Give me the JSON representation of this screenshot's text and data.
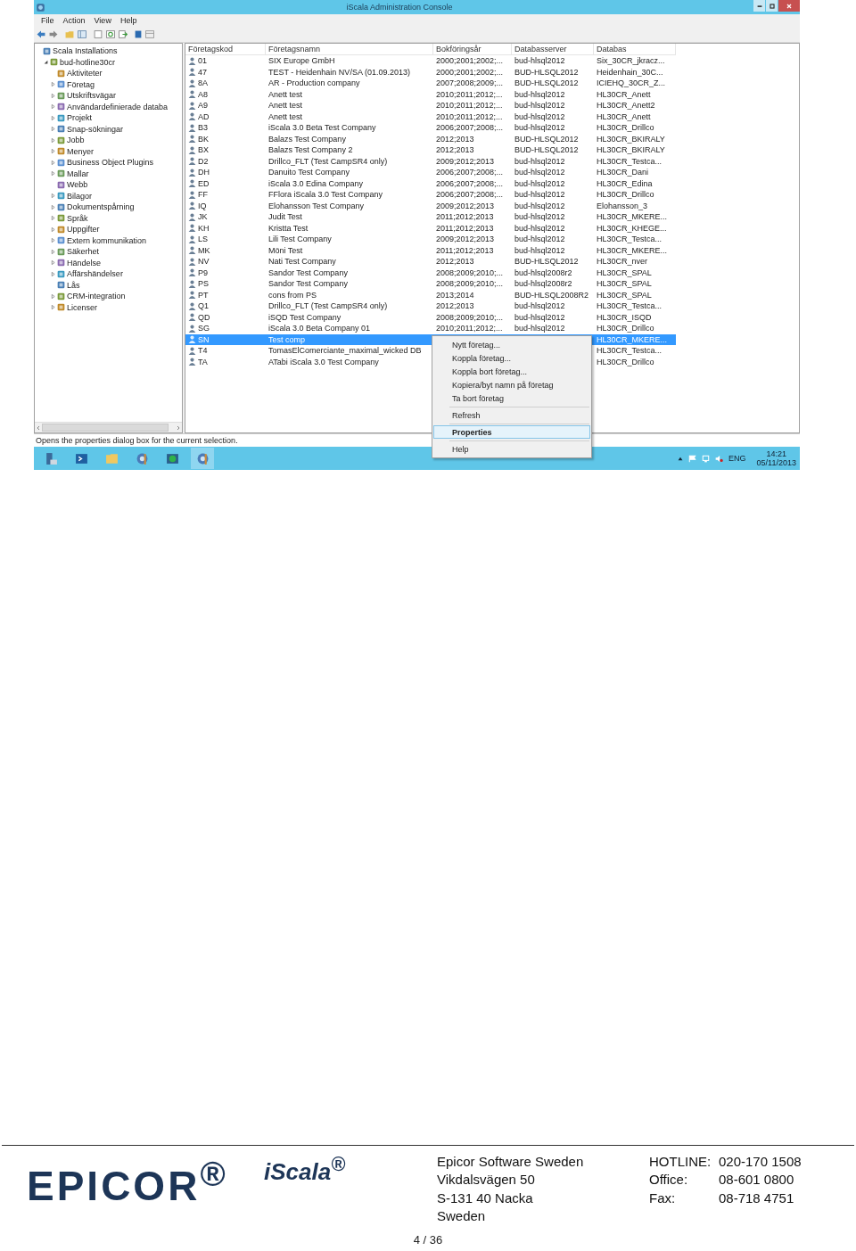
{
  "window": {
    "title": "iScala Administration Console"
  },
  "menu_bar": [
    "File",
    "Action",
    "View",
    "Help"
  ],
  "tree": [
    {
      "label": "Scala Installations",
      "children": [
        {
          "label": "bud-hotline30cr",
          "expanded": true,
          "children": [
            {
              "label": "Aktiviteter"
            },
            {
              "label": "Företag",
              "expanded": false
            },
            {
              "label": "Utskriftsvägar",
              "expanded": false
            },
            {
              "label": "Användardefinierade databa",
              "expanded": false
            },
            {
              "label": "Projekt",
              "expanded": false
            },
            {
              "label": "Snap-sökningar",
              "expanded": false
            },
            {
              "label": "Jobb",
              "expanded": false
            },
            {
              "label": "Menyer",
              "expanded": false
            },
            {
              "label": "Business Object Plugins",
              "expanded": false
            },
            {
              "label": "Mallar",
              "expanded": false
            },
            {
              "label": "Webb"
            },
            {
              "label": "Bilagor",
              "expanded": false
            },
            {
              "label": "Dokumentspårning",
              "expanded": false
            },
            {
              "label": "Språk",
              "expanded": false
            },
            {
              "label": "Uppgifter",
              "expanded": false
            },
            {
              "label": "Extern kommunikation",
              "expanded": false
            },
            {
              "label": "Säkerhet",
              "expanded": false
            },
            {
              "label": "Händelse",
              "expanded": false
            },
            {
              "label": "Affärshändelser",
              "expanded": false
            },
            {
              "label": "Lås"
            },
            {
              "label": "CRM-integration",
              "expanded": false
            },
            {
              "label": "Licenser",
              "expanded": false
            }
          ]
        }
      ]
    }
  ],
  "table": {
    "columns": [
      "Företagskod",
      "Företagsnamn",
      "Bokföringsår",
      "Databasserver",
      "Databas"
    ],
    "rows": [
      {
        "code": "01",
        "name": "SIX Europe GmbH",
        "years": "2000;2001;2002;...",
        "server": "bud-hlsql2012",
        "database": "Six_30CR_jkracz...",
        "selected": false
      },
      {
        "code": "47",
        "name": "TEST - Heidenhain NV/SA (01.09.2013)",
        "years": "2000;2001;2002;...",
        "server": "BUD-HLSQL2012",
        "database": "Heidenhain_30C...",
        "selected": false
      },
      {
        "code": "8A",
        "name": "AR - Production company",
        "years": "2007;2008;2009;...",
        "server": "BUD-HLSQL2012",
        "database": "ICIEHQ_30CR_Z...",
        "selected": false
      },
      {
        "code": "A8",
        "name": "Anett test",
        "years": "2010;2011;2012;...",
        "server": "bud-hlsql2012",
        "database": "HL30CR_Anett",
        "selected": false
      },
      {
        "code": "A9",
        "name": "Anett test",
        "years": "2010;2011;2012;...",
        "server": "bud-hlsql2012",
        "database": "HL30CR_Anett2",
        "selected": false
      },
      {
        "code": "AD",
        "name": "Anett test",
        "years": "2010;2011;2012;...",
        "server": "bud-hlsql2012",
        "database": "HL30CR_Anett",
        "selected": false
      },
      {
        "code": "B3",
        "name": "iScala 3.0 Beta Test Company",
        "years": "2006;2007;2008;...",
        "server": "bud-hlsql2012",
        "database": "HL30CR_Drillco",
        "selected": false
      },
      {
        "code": "BK",
        "name": "Balazs Test Company",
        "years": "2012;2013",
        "server": "BUD-HLSQL2012",
        "database": "HL30CR_BKIRALY",
        "selected": false
      },
      {
        "code": "BX",
        "name": "Balazs Test Company 2",
        "years": "2012;2013",
        "server": "BUD-HLSQL2012",
        "database": "HL30CR_BKIRALY",
        "selected": false
      },
      {
        "code": "D2",
        "name": "Drillco_FLT (Test CampSR4 only)",
        "years": "2009;2012;2013",
        "server": "bud-hlsql2012",
        "database": "HL30CR_Testca...",
        "selected": false
      },
      {
        "code": "DH",
        "name": "Danuito Test Company",
        "years": "2006;2007;2008;...",
        "server": "bud-hlsql2012",
        "database": "HL30CR_Dani",
        "selected": false
      },
      {
        "code": "ED",
        "name": "iScala 3.0 Edina Company",
        "years": "2006;2007;2008;...",
        "server": "bud-hlsql2012",
        "database": "HL30CR_Edina",
        "selected": false
      },
      {
        "code": "FF",
        "name": "FFlora iScala 3.0 Test Company",
        "years": "2006;2007;2008;...",
        "server": "bud-hlsql2012",
        "database": "HL30CR_Drillco",
        "selected": false
      },
      {
        "code": "IQ",
        "name": "Elohansson Test Company",
        "years": "2009;2012;2013",
        "server": "bud-hlsql2012",
        "database": "Elohansson_3",
        "selected": false
      },
      {
        "code": "JK",
        "name": "Judit Test",
        "years": "2011;2012;2013",
        "server": "bud-hlsql2012",
        "database": "HL30CR_MKERE...",
        "selected": false
      },
      {
        "code": "KH",
        "name": "Kristta Test",
        "years": "2011;2012;2013",
        "server": "bud-hlsql2012",
        "database": "HL30CR_KHEGE...",
        "selected": false
      },
      {
        "code": "LS",
        "name": "Lili Test Company",
        "years": "2009;2012;2013",
        "server": "bud-hlsql2012",
        "database": "HL30CR_Testca...",
        "selected": false
      },
      {
        "code": "MK",
        "name": "Möni Test",
        "years": "2011;2012;2013",
        "server": "bud-hlsql2012",
        "database": "HL30CR_MKERE...",
        "selected": false
      },
      {
        "code": "NV",
        "name": "Nati Test Company",
        "years": "2012;2013",
        "server": "BUD-HLSQL2012",
        "database": "HL30CR_nver",
        "selected": false
      },
      {
        "code": "P9",
        "name": "Sandor Test Company",
        "years": "2008;2009;2010;...",
        "server": "bud-hlsql2008r2",
        "database": "HL30CR_SPAL",
        "selected": false
      },
      {
        "code": "PS",
        "name": "Sandor Test Company",
        "years": "2008;2009;2010;...",
        "server": "bud-hlsql2008r2",
        "database": "HL30CR_SPAL",
        "selected": false
      },
      {
        "code": "PT",
        "name": "cons from PS",
        "years": "2013;2014",
        "server": "BUD-HLSQL2008R2",
        "database": "HL30CR_SPAL",
        "selected": false
      },
      {
        "code": "Q1",
        "name": "Drillco_FLT (Test CampSR4 only)",
        "years": "2012;2013",
        "server": "bud-hlsql2012",
        "database": "HL30CR_Testca...",
        "selected": false
      },
      {
        "code": "QD",
        "name": "iSQD Test Company",
        "years": "2008;2009;2010;...",
        "server": "bud-hlsql2012",
        "database": "HL30CR_ISQD",
        "selected": false
      },
      {
        "code": "SG",
        "name": "iScala 3.0 Beta Company 01",
        "years": "2010;2011;2012;...",
        "server": "bud-hlsql2012",
        "database": "HL30CR_Drillco",
        "selected": false
      },
      {
        "code": "SN",
        "name": "Test comp",
        "database": "HL30CR_MKERE...",
        "selected": true
      },
      {
        "code": "T4",
        "name": "TomasElComerciante_maximal_wicked DB",
        "database": "HL30CR_Testca...",
        "selected": false
      },
      {
        "code": "TA",
        "name": "ATabi iScala 3.0 Test Company",
        "database": "HL30CR_Drillco",
        "selected": false
      }
    ]
  },
  "context_menu": [
    {
      "kind": "item",
      "label": "Nytt företag...",
      "selected": false,
      "default": false
    },
    {
      "kind": "item",
      "label": "Koppla företag...",
      "selected": false,
      "default": false
    },
    {
      "kind": "item",
      "label": "Koppla bort företag...",
      "selected": false,
      "default": false
    },
    {
      "kind": "item",
      "label": "Kopiera/byt namn på företag",
      "selected": false,
      "default": false
    },
    {
      "kind": "item",
      "label": "Ta bort företag",
      "selected": false,
      "default": false
    },
    {
      "kind": "separator"
    },
    {
      "kind": "item",
      "label": "Refresh",
      "selected": false,
      "default": false
    },
    {
      "kind": "separator"
    },
    {
      "kind": "item",
      "label": "Properties",
      "selected": true,
      "default": true
    },
    {
      "kind": "separator"
    },
    {
      "kind": "item",
      "label": "Help",
      "selected": false,
      "default": false
    }
  ],
  "status_bar": "Opens the properties dialog box for the current selection.",
  "taskbar": {
    "language": "ENG",
    "time": "14:21",
    "date": "05/11/2013"
  },
  "footer": {
    "logo": "EPICOR$^{®}$",
    "product_logo": "iScala$^{®}$",
    "address": [
      "Epicor Software Sweden",
      "Vikdalsvägen 50",
      "S-131 40 Nacka",
      "Sweden"
    ],
    "contacts": [
      {
        "label": "HOTLINE:",
        "value": "020-170 1508"
      },
      {
        "label": "Office:",
        "value": "08-601 0800"
      },
      {
        "label": "Fax:",
        "value": "08-718 4751"
      }
    ],
    "page": "4 / 36"
  }
}
